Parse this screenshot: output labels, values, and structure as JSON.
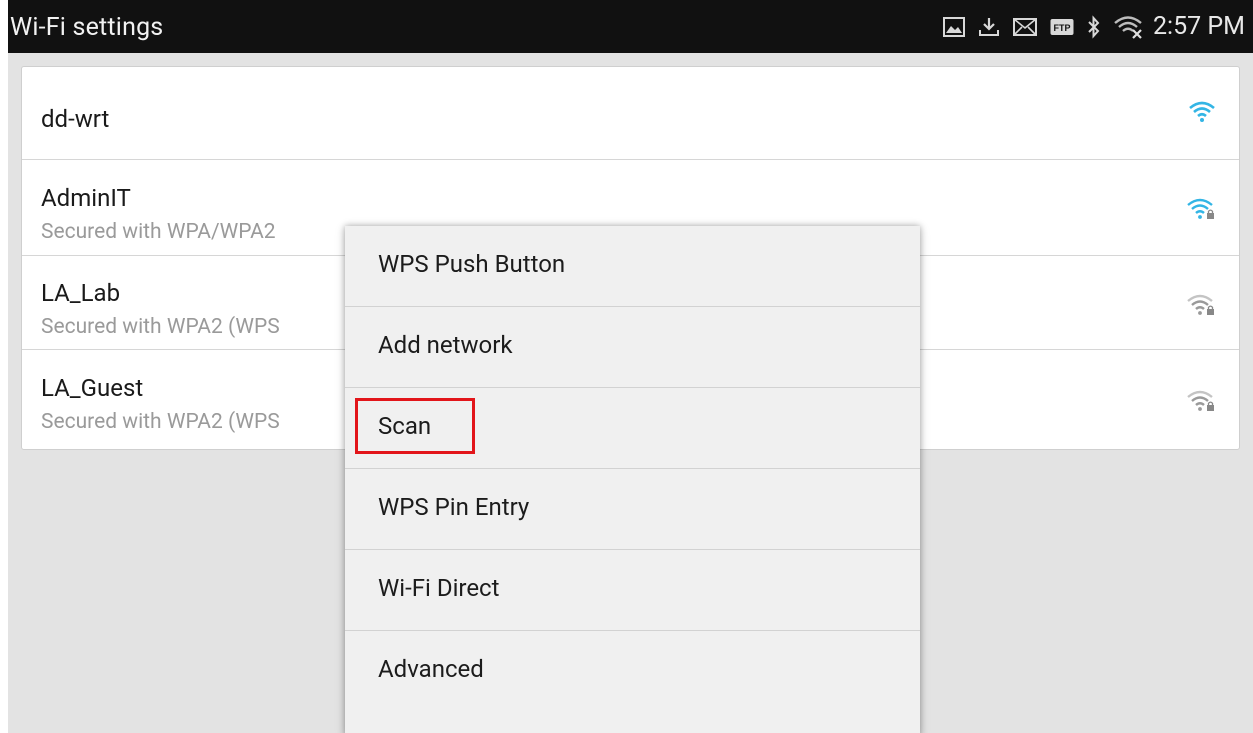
{
  "statusbar": {
    "title": "Wi-Fi settings",
    "time": "2:57 PM",
    "icons": [
      "gallery-icon",
      "download-icon",
      "mail-icon",
      "ftp-icon",
      "bluetooth-icon",
      "wifi-off-icon"
    ],
    "ftp_label": "FTP"
  },
  "networks": [
    {
      "name": "dd-wrt",
      "security": "",
      "signal": "strong-open",
      "color": "#33b5e5"
    },
    {
      "name": "AdminIT",
      "security": "Secured with WPA/WPA2",
      "signal": "locked",
      "color": "#33b5e5"
    },
    {
      "name": "LA_Lab",
      "security": "Secured with WPA2 (WPS",
      "signal": "locked",
      "color": "#9a9a9a"
    },
    {
      "name": "LA_Guest",
      "security": "Secured with WPA2 (WPS",
      "signal": "locked",
      "color": "#9a9a9a"
    }
  ],
  "menu": {
    "items": [
      {
        "label": "WPS Push Button"
      },
      {
        "label": "Add network"
      },
      {
        "label": "Scan"
      },
      {
        "label": "WPS Pin Entry"
      },
      {
        "label": "Wi-Fi Direct"
      },
      {
        "label": "Advanced"
      }
    ],
    "highlight_color": "#e2151a"
  }
}
